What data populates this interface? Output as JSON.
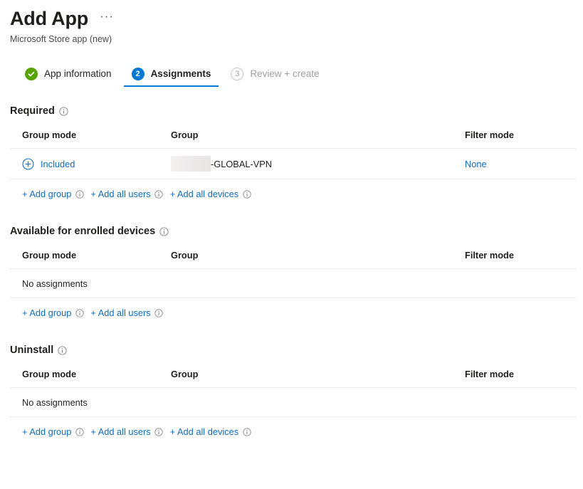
{
  "header": {
    "title": "Add App",
    "subtitle": "Microsoft Store app (new)",
    "more_menu": "···"
  },
  "wizard": {
    "steps": [
      {
        "number": "",
        "label": "App information",
        "state": "completed",
        "icon": "check-icon"
      },
      {
        "number": "2",
        "label": "Assignments",
        "state": "current",
        "icon": "step-number-badge"
      },
      {
        "number": "3",
        "label": "Review + create",
        "state": "disabled",
        "icon": "step-number-badge"
      }
    ]
  },
  "columns": {
    "group_mode": "Group mode",
    "group": "Group",
    "filter_mode": "Filter mode"
  },
  "sections": [
    {
      "heading": "Required",
      "info_icon": "info-icon",
      "rows": [
        {
          "mode_icon": "plus-circle-icon",
          "mode": "Included",
          "group_redacted": true,
          "group": "-GLOBAL-VPN",
          "filter_mode": "None"
        }
      ],
      "empty_text": "",
      "actions": [
        {
          "label": "+ Add group",
          "info_icon": "info-icon"
        },
        {
          "label": "+ Add all users",
          "info_icon": "info-icon"
        },
        {
          "label": "+ Add all devices",
          "info_icon": "info-icon"
        }
      ]
    },
    {
      "heading": "Available for enrolled devices",
      "info_icon": "info-icon",
      "rows": [],
      "empty_text": "No assignments",
      "actions": [
        {
          "label": "+ Add group",
          "info_icon": "info-icon"
        },
        {
          "label": "+ Add all users",
          "info_icon": "info-icon"
        }
      ]
    },
    {
      "heading": "Uninstall",
      "info_icon": "info-icon",
      "rows": [],
      "empty_text": "No assignments",
      "actions": [
        {
          "label": "+ Add group",
          "info_icon": "info-icon"
        },
        {
          "label": "+ Add all users",
          "info_icon": "info-icon"
        },
        {
          "label": "+ Add all devices",
          "info_icon": "info-icon"
        }
      ]
    }
  ],
  "colors": {
    "accent": "#0078d4",
    "link": "#0f6cbd",
    "success": "#57a300",
    "disabled": "#a19f9d",
    "border": "#edebe9",
    "text": "#201f1e"
  }
}
